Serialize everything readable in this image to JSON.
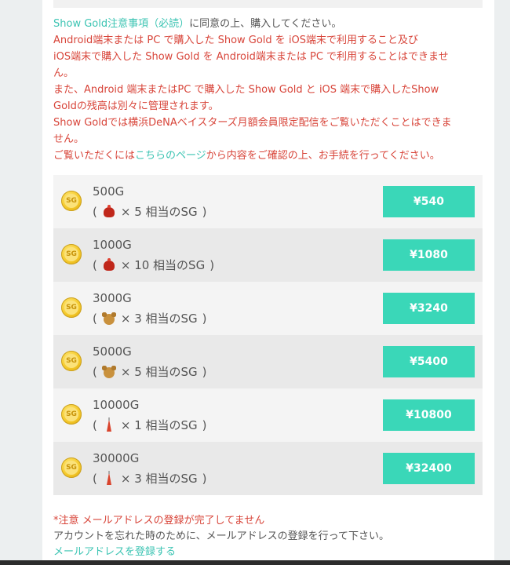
{
  "notice": {
    "line1_link": "Show Gold注意事項（必読）",
    "line1_text": "に同意の上、購入してください。",
    "line2": "Android端末または PC で購入した Show Gold を iOS端末で利用すること及び",
    "line3": "iOS端末で購入した Show Gold を Android端末または PC で利用することはできませ",
    "line4": "ん。",
    "line5": "また、Android 端末またはPC で購入した Show Gold と iOS 端末で購入したShow",
    "line6": "Goldの残高は別々に管理されます。",
    "line7": "Show Goldでは横浜DeNAベイスターズ月額会員限定配信をご覧いただくことはできま",
    "line8": "せん。",
    "line9_pre": "ご覧いただくには",
    "line9_link": "こちらのページ",
    "line9_post": "から内容をご確認の上、お手続を行ってください。"
  },
  "coin_label": "SG",
  "plans": [
    {
      "gold": "500G",
      "open": "(",
      "icon": "hat",
      "count": "× 5 相当のSG",
      "close": ")",
      "price": "¥540"
    },
    {
      "gold": "1000G",
      "open": "(",
      "icon": "hat",
      "count": "× 10 相当のSG",
      "close": ")",
      "price": "¥1080"
    },
    {
      "gold": "3000G",
      "open": "(",
      "icon": "bear",
      "count": "× 3 相当のSG",
      "close": ")",
      "price": "¥3240"
    },
    {
      "gold": "5000G",
      "open": "(",
      "icon": "bear",
      "count": "× 5 相当のSG",
      "close": ")",
      "price": "¥5400"
    },
    {
      "gold": "10000G",
      "open": "(",
      "icon": "tower",
      "count": "× 1 相当のSG",
      "close": ")",
      "price": "¥10800"
    },
    {
      "gold": "30000G",
      "open": "(",
      "icon": "tower",
      "count": "× 3 相当のSG",
      "close": ")",
      "price": "¥32400"
    }
  ],
  "footer": {
    "warning": "*注意 メールアドレスの登録が完了してません",
    "info": "アカウントを忘れた時のために、メールアドレスの登録を行って下さい。",
    "link": "メールアドレスを登録する"
  },
  "colors": {
    "accent": "#3ad7b8",
    "warning": "#d8453a",
    "link": "#3cc4b3"
  }
}
